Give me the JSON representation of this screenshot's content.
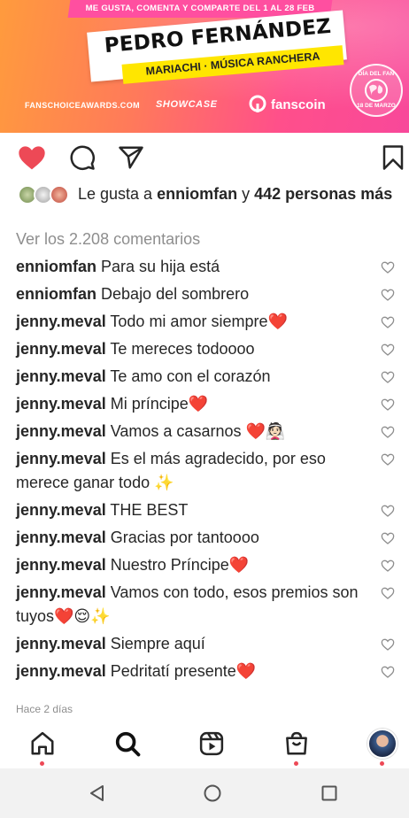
{
  "banner": {
    "tagline": "ME GUSTA, COMENTA Y COMPARTE DEL 1 AL 28 FEB",
    "artist": "PEDRO FERNÁNDEZ",
    "genre": "MARIACHI · MÚSICA RANCHERA",
    "site": "FANSCHOICEAWARDS.COM",
    "showcase": "SHOWCASE",
    "fanscoin": "fanscoin",
    "badge_top": "DÍA DEL FAN",
    "badge_bottom": "18 DE MARZO",
    "colors": {
      "gradient_start": "#ff9b3d",
      "gradient_end": "#f8489a",
      "genre_bg": "#ffe600"
    }
  },
  "actions": {
    "like_icon": "heart-filled-icon",
    "comment_icon": "comment-bubble-icon",
    "share_icon": "paper-plane-icon",
    "save_icon": "bookmark-icon",
    "like_color": "#ed4956"
  },
  "likes": {
    "prefix": "Le gusta a",
    "user": "enniomfan",
    "conjunction": "y",
    "others": "442 personas más"
  },
  "view_all_comments": "Ver los 2.208 comentarios",
  "comments": [
    {
      "user": "enniomfan",
      "text": "Para su hija está"
    },
    {
      "user": "enniomfan",
      "text": "Debajo del sombrero"
    },
    {
      "user": "jenny.meval",
      "text": "Todo mi amor siempre❤️"
    },
    {
      "user": "jenny.meval",
      "text": "Te mereces todoooo"
    },
    {
      "user": "jenny.meval",
      "text": "Te amo con el corazón"
    },
    {
      "user": "jenny.meval",
      "text": "Mi príncipe❤️"
    },
    {
      "user": "jenny.meval",
      "text": "Vamos a casarnos ❤️👰🏻"
    },
    {
      "user": "jenny.meval",
      "text": "Es el más agradecido, por eso merece ganar todo ✨"
    },
    {
      "user": "jenny.meval",
      "text": "THE BEST"
    },
    {
      "user": "jenny.meval",
      "text": "Gracias por tantoooo"
    },
    {
      "user": "jenny.meval",
      "text": "Nuestro Príncipe❤️"
    },
    {
      "user": "jenny.meval",
      "text": "Vamos con todo, esos premios son tuyos❤️😌✨"
    },
    {
      "user": "jenny.meval",
      "text": "Siempre aquí"
    },
    {
      "user": "jenny.meval",
      "text": "Pedritatí presente❤️"
    }
  ],
  "timestamp": "Hace 2 días",
  "nav": {
    "home_icon": "home-icon",
    "search_icon": "search-icon",
    "reels_icon": "reels-icon",
    "shop_icon": "shop-bag-icon",
    "profile_icon": "profile-avatar"
  },
  "system": {
    "back_icon": "back-triangle-icon",
    "home_icon": "home-circle-icon",
    "recents_icon": "recents-square-icon"
  }
}
